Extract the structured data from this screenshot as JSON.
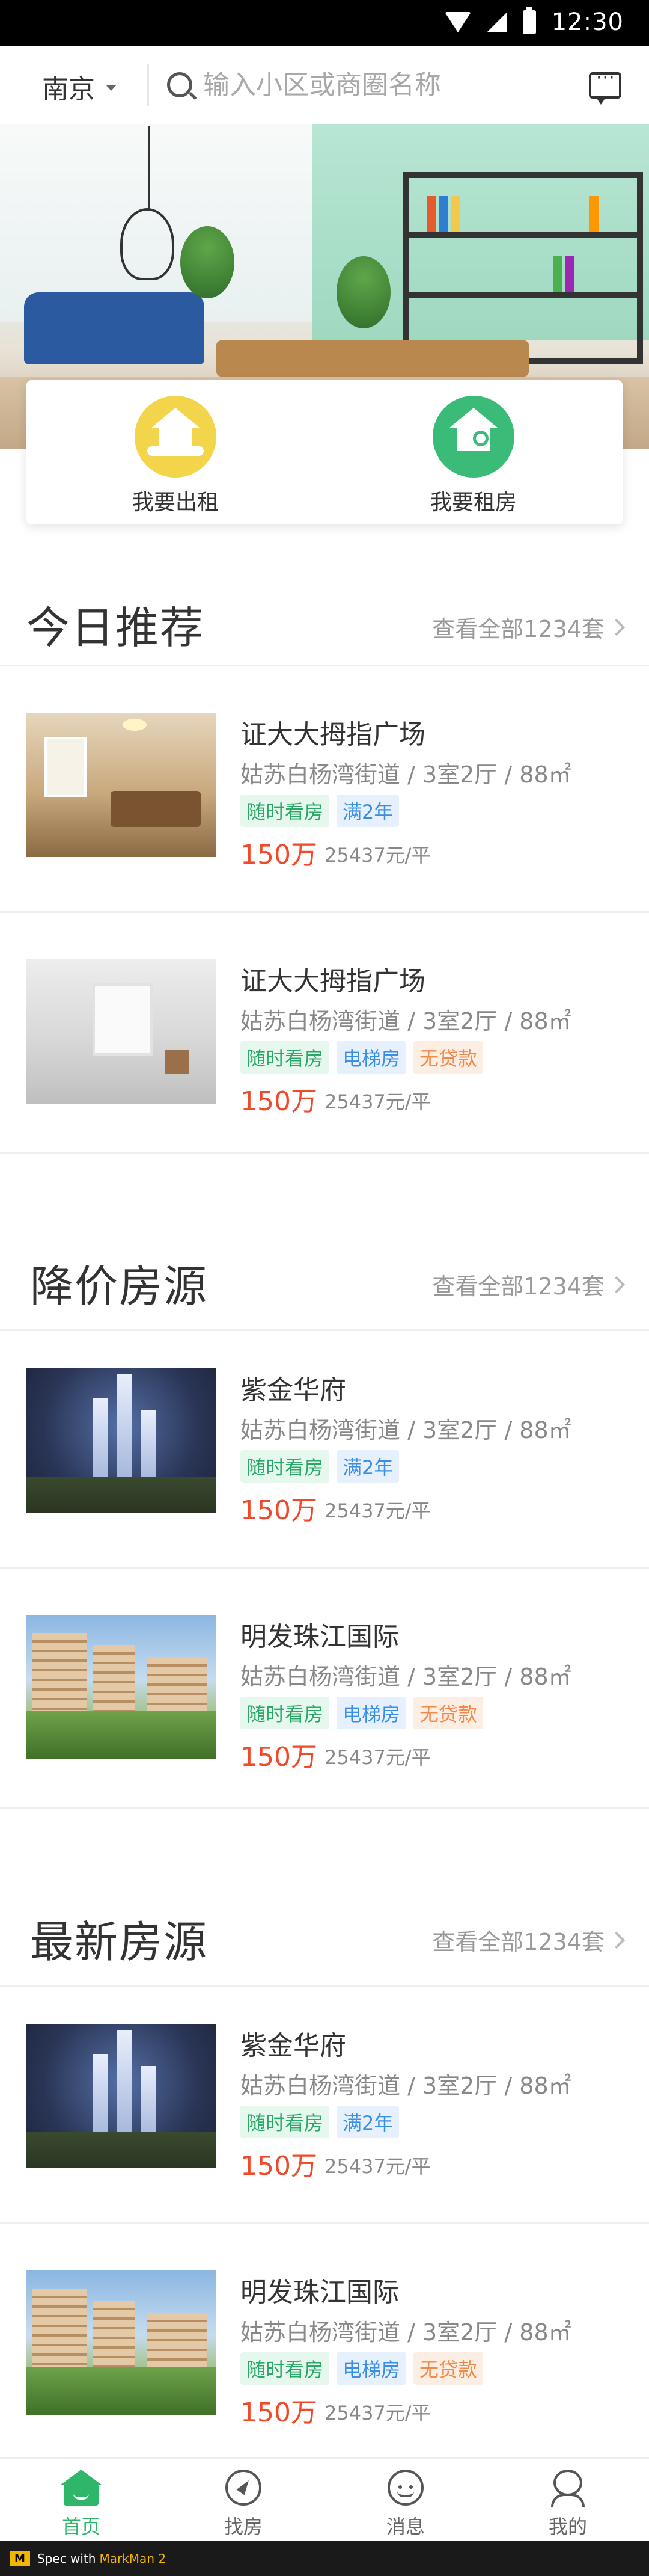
{
  "status_bar": {
    "time": "12:30"
  },
  "header": {
    "city": "南京",
    "search_placeholder": "输入小区或商圈名称",
    "message_icon": "message-icon"
  },
  "quick_actions": [
    {
      "label": "我要出租",
      "icon": "house-hand-icon",
      "color": "#f2d54b"
    },
    {
      "label": "我要租房",
      "icon": "house-key-icon",
      "color": "#3bbb78"
    }
  ],
  "sections": [
    {
      "title": "今日推荐",
      "view_all": "查看全部1234套",
      "listings": [
        {
          "name": "证大大拇指广场",
          "address": "姑苏白杨湾街道 / 3室2厅 / 88㎡",
          "tags": [
            "随时看房",
            "满2年"
          ],
          "price": "150万",
          "unit_price": "25437元/平"
        },
        {
          "name": "证大大拇指广场",
          "address": "姑苏白杨湾街道 / 3室2厅 / 88㎡",
          "tags": [
            "随时看房",
            "电梯房",
            "无贷款"
          ],
          "price": "150万",
          "unit_price": "25437元/平"
        }
      ]
    },
    {
      "title": "降价房源",
      "view_all": "查看全部1234套",
      "listings": [
        {
          "name": "紫金华府",
          "address": "姑苏白杨湾街道 / 3室2厅 / 88㎡",
          "tags": [
            "随时看房",
            "满2年"
          ],
          "price": "150万",
          "unit_price": "25437元/平"
        },
        {
          "name": "明发珠江国际",
          "address": "姑苏白杨湾街道 / 3室2厅 / 88㎡",
          "tags": [
            "随时看房",
            "电梯房",
            "无贷款"
          ],
          "price": "150万",
          "unit_price": "25437元/平"
        }
      ]
    },
    {
      "title": "最新房源",
      "view_all": "查看全部1234套",
      "listings": [
        {
          "name": "紫金华府",
          "address": "姑苏白杨湾街道 / 3室2厅 / 88㎡",
          "tags": [
            "随时看房",
            "满2年"
          ],
          "price": "150万",
          "unit_price": "25437元/平"
        },
        {
          "name": "明发珠江国际",
          "address": "姑苏白杨湾街道 / 3室2厅 / 88㎡",
          "tags": [
            "随时看房",
            "电梯房",
            "无贷款"
          ],
          "price": "150万",
          "unit_price": "25437元/平"
        }
      ]
    }
  ],
  "tabbar": [
    {
      "label": "首页",
      "icon": "home-icon",
      "active": true
    },
    {
      "label": "找房",
      "icon": "compass-icon",
      "active": false
    },
    {
      "label": "消息",
      "icon": "smile-icon",
      "active": false
    },
    {
      "label": "我的",
      "icon": "person-icon",
      "active": false
    }
  ],
  "footer": {
    "badge": "M",
    "text": "Spec with",
    "accent": "MarkMan 2"
  },
  "colors": {
    "accent_green": "#2fb66a",
    "price_red": "#f04a2b",
    "tag_green": "#2aa866",
    "tag_blue": "#3a8ee6",
    "tag_orange": "#f08a4b"
  }
}
